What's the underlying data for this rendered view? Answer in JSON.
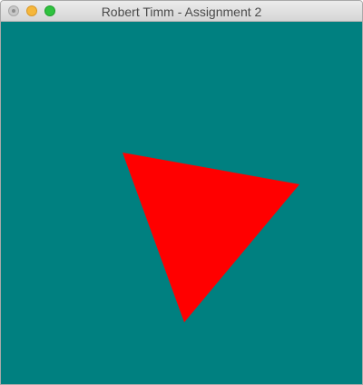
{
  "window": {
    "title": "Robert Timm - Assignment 2"
  },
  "colors": {
    "background": "#008080",
    "triangle_fill": "#ff0000"
  },
  "icons": {
    "close": "close-icon",
    "minimize": "minimize-icon",
    "zoom": "zoom-icon"
  }
}
